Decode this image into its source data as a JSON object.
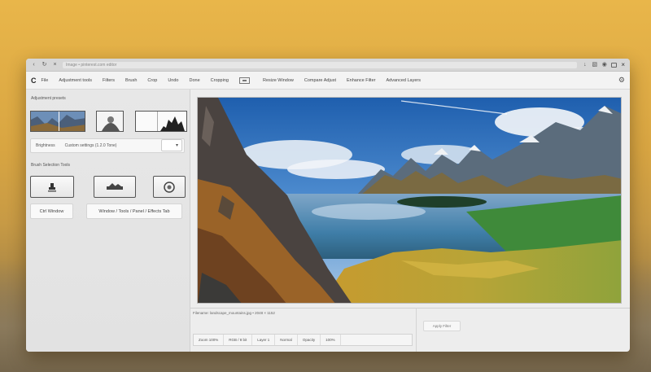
{
  "browser": {
    "url_text": "Image • pinterest.com editor",
    "back_icon": "back-arrow-icon",
    "reload_icon": "reload-icon",
    "close_icon": "close-icon"
  },
  "toolbar": {
    "logo": "C",
    "items": [
      "File",
      "Adjustment tools",
      "Filters",
      "Brush",
      "Crop",
      "Undo",
      "Done",
      "Cropping",
      "Background"
    ],
    "right_items": [
      "Resize Window",
      "Compare Adjust",
      "Enhance Filter",
      "Advanced Layers"
    ]
  },
  "left_panel": {
    "section_title": "Adjustment presets",
    "preset_field": "Brightness",
    "preset_field_value": "Custom settings (1.2.0 Tone)",
    "select_value": "▾",
    "section2_title": "Brush Selection Tools",
    "btn_window": "Ctrl Window",
    "btn_window_tools": "Window / Tools / Panel / Effects Tab"
  },
  "canvas": {
    "alt": "mountain-lake-landscape"
  },
  "bottom": {
    "line_text": "Filename: landscape_mountains.jpg  •  2048 × 1152",
    "status_cells": [
      "Zoom 100%",
      "RGB / 8 bit",
      "Layer 1",
      "Normal",
      "Opacity",
      "100%"
    ],
    "apply_button": "Apply Filter"
  },
  "colors": {
    "accent": "#3a6fb0",
    "window_bg": "#ededed",
    "wall": "#e0ae48"
  }
}
